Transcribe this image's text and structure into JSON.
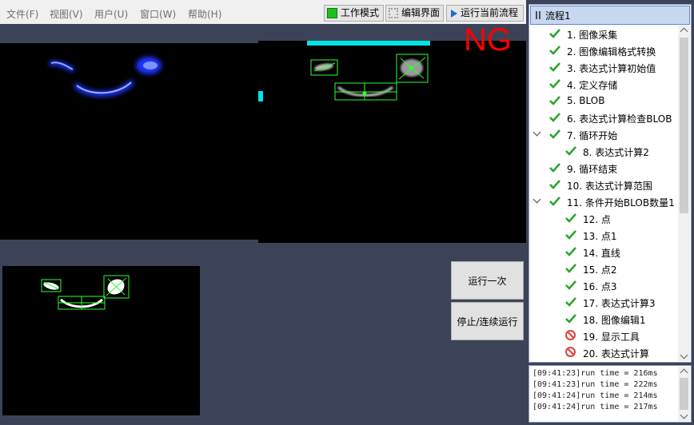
{
  "menu": [
    "文件(F)",
    "视图(V)",
    "用户(U)",
    "窗口(W)",
    "帮助(H)"
  ],
  "toolbar": {
    "work_mode": "工作模式",
    "edit_ui": "编辑界面",
    "run_current": "运行当前流程"
  },
  "status": {
    "result": "NG"
  },
  "actions": {
    "run_once": "运行一次",
    "stop_continuous": "停止/连续运行"
  },
  "flow": {
    "title": "流程1",
    "steps": [
      {
        "label": "1. 图像采集",
        "status": "ok"
      },
      {
        "label": "2. 图像编辑格式转换",
        "status": "ok"
      },
      {
        "label": "3. 表达式计算初始值",
        "status": "ok"
      },
      {
        "label": "4. 定义存储",
        "status": "ok"
      },
      {
        "label": "5. BLOB",
        "status": "ok"
      },
      {
        "label": "6. 表达式计算检查BLOB",
        "status": "ok"
      },
      {
        "label": "7. 循环开始",
        "status": "ok",
        "expandable": true
      },
      {
        "label": "8. 表达式计算2",
        "status": "ok"
      },
      {
        "label": "9. 循环结束",
        "status": "ok"
      },
      {
        "label": "10. 表达式计算范围",
        "status": "ok"
      },
      {
        "label": "11. 条件开始BLOB数量1",
        "status": "ok",
        "expandable": true
      },
      {
        "label": "12. 点",
        "status": "ok"
      },
      {
        "label": "13. 点1",
        "status": "ok"
      },
      {
        "label": "14. 直线",
        "status": "ok"
      },
      {
        "label": "15. 点2",
        "status": "ok"
      },
      {
        "label": "16. 点3",
        "status": "ok"
      },
      {
        "label": "17. 表达式计算3",
        "status": "ok"
      },
      {
        "label": "18. 图像编辑1",
        "status": "ok"
      },
      {
        "label": "19. 显示工具",
        "status": "disabled"
      },
      {
        "label": "20. 表达式计算",
        "status": "disabled"
      }
    ]
  },
  "log": [
    "[09:41:23]run time = 216ms",
    "[09:41:23]run time = 222ms",
    "[09:41:24]run time = 214ms",
    "[09:41:24]run time = 217ms"
  ],
  "colors": {
    "background": "#3c4359",
    "ng": "#ff0000",
    "ok_check": "#2aa52a",
    "disabled": "#e0413c",
    "roi_box": "#30ff30",
    "highlight": "#00e5e5"
  }
}
